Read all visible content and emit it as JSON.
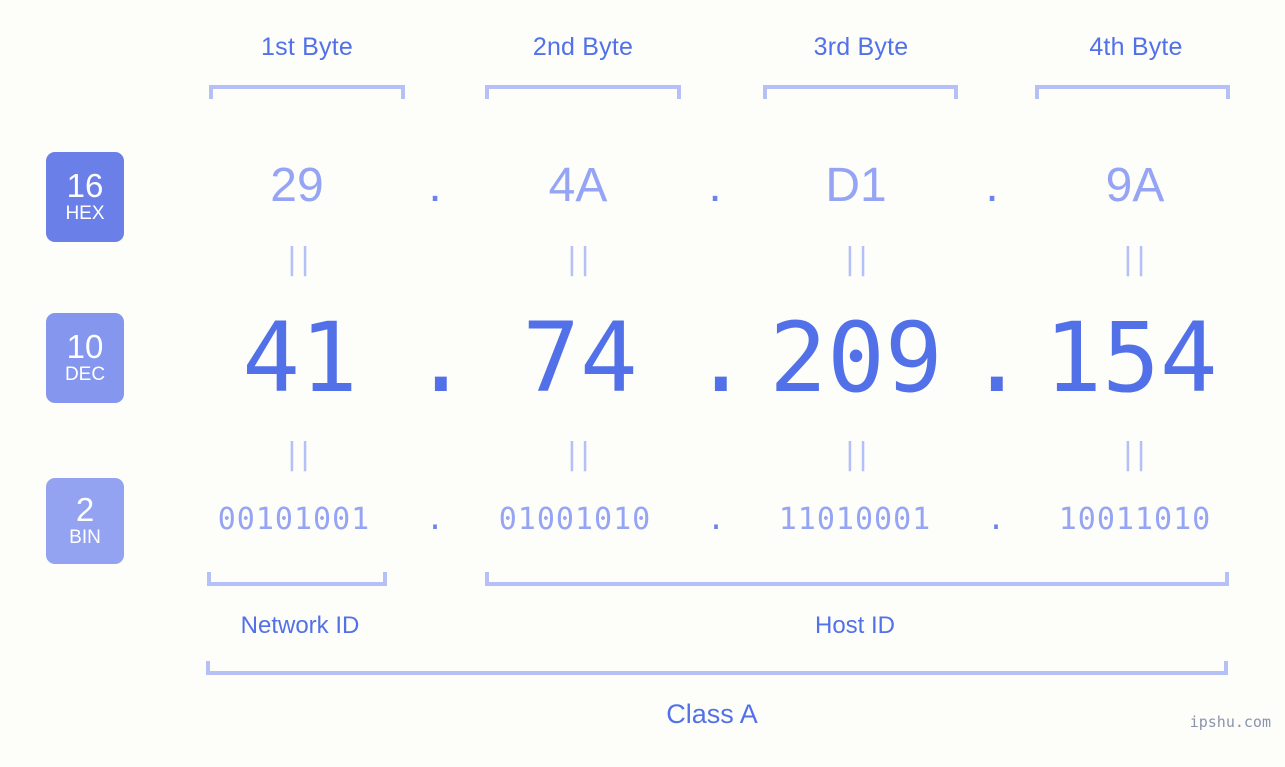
{
  "background_color": "#fdfdfa",
  "colors": {
    "accent_strong": "#5271e8",
    "accent_light": "#95a4f4",
    "bracket": "#b5c0f7",
    "badge_hex": "#6b7fe8",
    "badge_dec": "#8496ee",
    "badge_bin": "#93a3f2",
    "watermark": "#8b93ad"
  },
  "byte_headers": [
    {
      "label": "1st Byte"
    },
    {
      "label": "2nd Byte"
    },
    {
      "label": "3rd Byte"
    },
    {
      "label": "4th Byte"
    }
  ],
  "rows": {
    "hex": {
      "badge_number": "16",
      "badge_label": "HEX",
      "values": [
        "29",
        "4A",
        "D1",
        "9A"
      ],
      "separator": "."
    },
    "dec": {
      "badge_number": "10",
      "badge_label": "DEC",
      "values": [
        "41",
        "74",
        "209",
        "154"
      ],
      "separator": "."
    },
    "bin": {
      "badge_number": "2",
      "badge_label": "BIN",
      "values": [
        "00101001",
        "01001010",
        "11010001",
        "10011010"
      ],
      "separator": "."
    }
  },
  "equals_marks": {
    "glyph": "||",
    "count_top": 4,
    "count_bottom": 4
  },
  "sections": [
    {
      "label": "Network ID"
    },
    {
      "label": "Host ID"
    }
  ],
  "class": {
    "label": "Class A"
  },
  "watermark": {
    "text": "ipshu.com"
  }
}
